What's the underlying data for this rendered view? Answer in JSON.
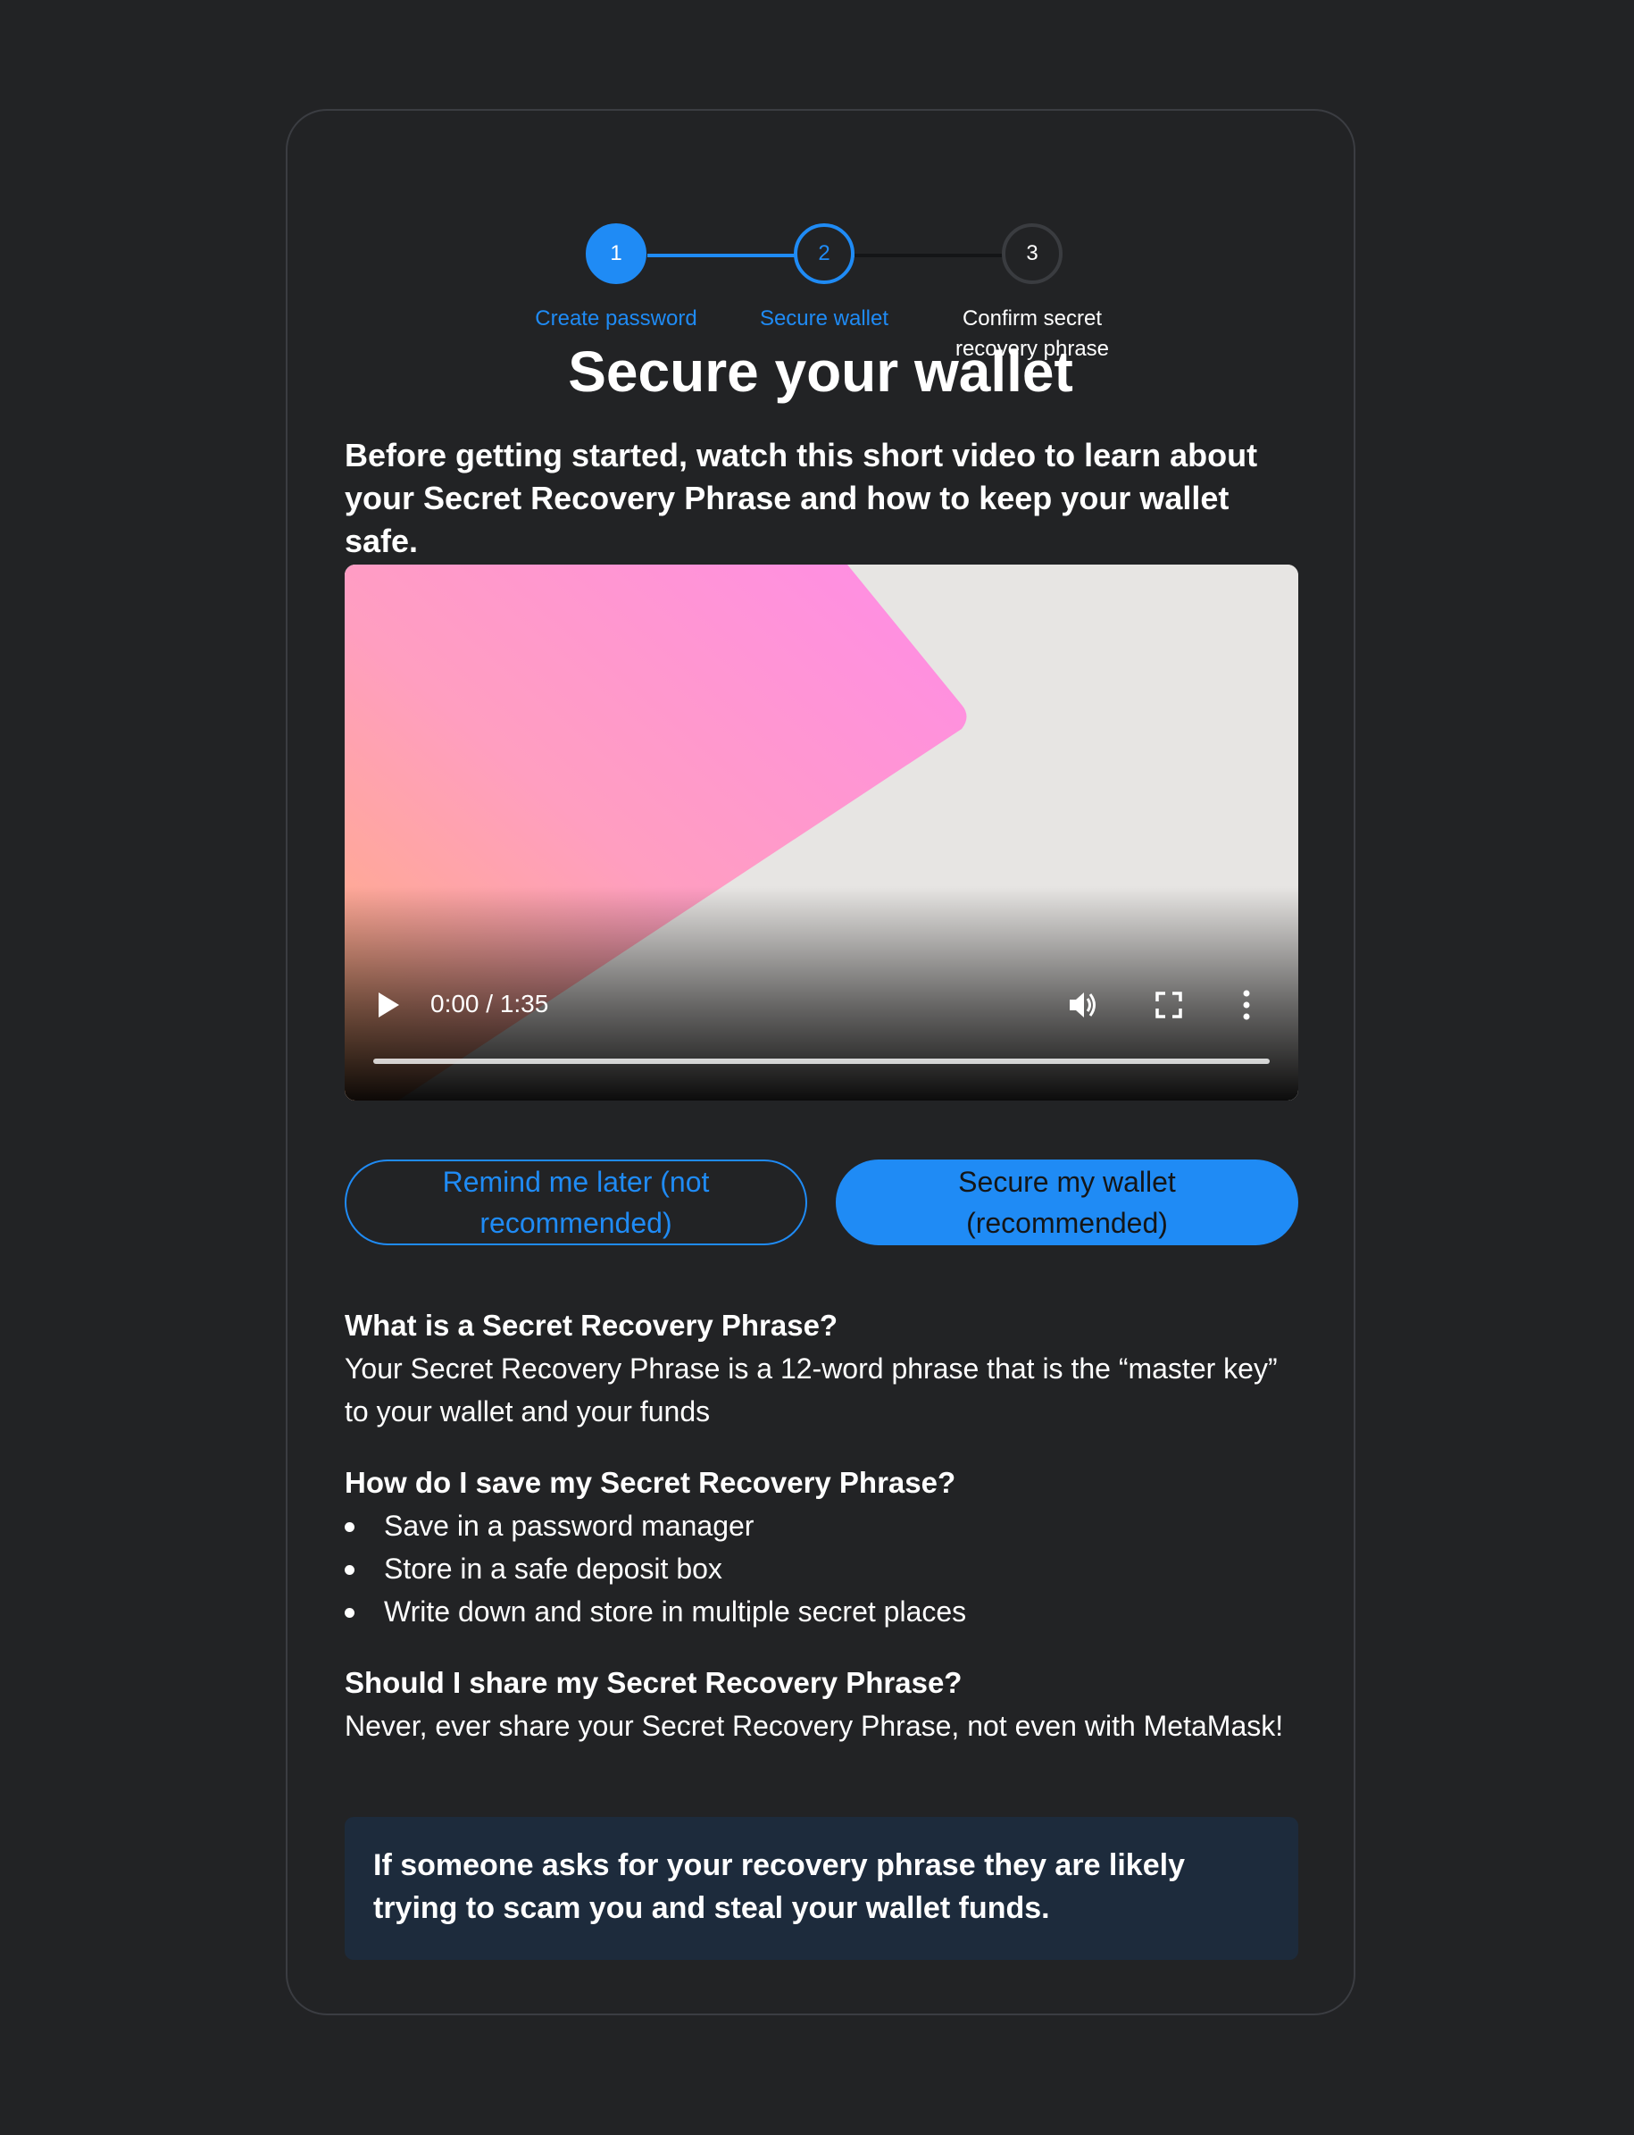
{
  "stepper": {
    "steps": [
      {
        "number": "1",
        "label": "Create password",
        "state": "complete"
      },
      {
        "number": "2",
        "label": "Secure wallet",
        "state": "active"
      },
      {
        "number": "3",
        "label": "Confirm secret recovery phrase",
        "state": "pending"
      }
    ]
  },
  "page": {
    "title": "Secure your wallet",
    "intro": "Before getting started, watch this short video to learn about your Secret Recovery Phrase and how to keep your wallet safe."
  },
  "video": {
    "time": "0:00 / 1:35",
    "progress": 0,
    "icons": {
      "play": "play-icon",
      "volume": "volume-icon",
      "fullscreen": "fullscreen-icon",
      "more": "more-vertical-icon"
    }
  },
  "buttons": {
    "remind_later": "Remind me later (not recommended)",
    "secure_wallet": "Secure my wallet (recommended)"
  },
  "info": {
    "what_title": "What is a Secret Recovery Phrase?",
    "what_body": "Your Secret Recovery Phrase is a 12-word phrase that is the “master key” to your wallet and your funds",
    "how_title": "How do I save my Secret Recovery Phrase?",
    "how_items": [
      "Save in a password manager",
      "Store in a safe deposit box",
      "Write down and store in multiple secret places"
    ],
    "share_title": "Should I share my Secret Recovery Phrase?",
    "share_body": "Never, ever share your Secret Recovery Phrase, not even with MetaMask!"
  },
  "warning": {
    "text": "If someone asks for your recovery phrase they are likely trying to scam you and steal your wallet funds."
  },
  "colors": {
    "background": "#222325",
    "accent": "#1f8bf5",
    "warning_bg": "#1d2b3c",
    "text": "#ffffff"
  }
}
